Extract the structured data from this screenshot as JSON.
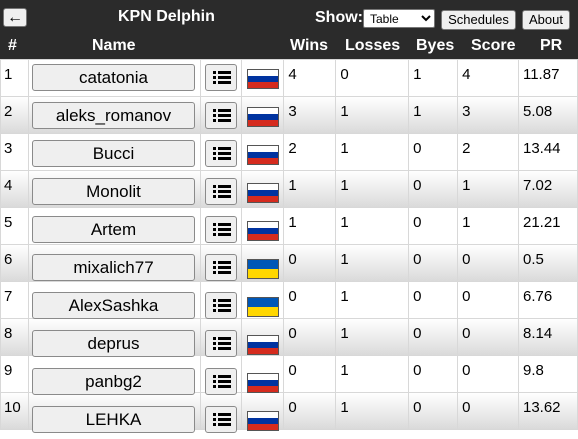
{
  "header": {
    "back_icon": "arrow-left-icon",
    "title": "KPN Delphin",
    "show_label": "Show:",
    "show_selected": "Table",
    "schedules_label": "Schedules",
    "about_label": "About"
  },
  "columns": {
    "rank": "#",
    "name": "Name",
    "wins": "Wins",
    "losses": "Losses",
    "byes": "Byes",
    "score": "Score",
    "pr": "PR"
  },
  "flag_colors": {
    "ru": [
      "#ffffff",
      "#0033a0",
      "#d52b1e"
    ],
    "ua": [
      "#0057b7",
      "#ffd700"
    ]
  },
  "rows": [
    {
      "rank": "1",
      "name": "catatonia",
      "flag": "ru",
      "wins": "4",
      "losses": "0",
      "byes": "1",
      "score": "4",
      "pr": "11.87"
    },
    {
      "rank": "2",
      "name": "aleks_romanov",
      "flag": "ru",
      "wins": "3",
      "losses": "1",
      "byes": "1",
      "score": "3",
      "pr": "5.08"
    },
    {
      "rank": "3",
      "name": "Bucci",
      "flag": "ru",
      "wins": "2",
      "losses": "1",
      "byes": "0",
      "score": "2",
      "pr": "13.44"
    },
    {
      "rank": "4",
      "name": "Monolit",
      "flag": "ru",
      "wins": "1",
      "losses": "1",
      "byes": "0",
      "score": "1",
      "pr": "7.02"
    },
    {
      "rank": "5",
      "name": "Artem",
      "flag": "ru",
      "wins": "1",
      "losses": "1",
      "byes": "0",
      "score": "1",
      "pr": "21.21"
    },
    {
      "rank": "6",
      "name": "mixalich77",
      "flag": "ua",
      "wins": "0",
      "losses": "1",
      "byes": "0",
      "score": "0",
      "pr": "0.5"
    },
    {
      "rank": "7",
      "name": "AlexSashka",
      "flag": "ua",
      "wins": "0",
      "losses": "1",
      "byes": "0",
      "score": "0",
      "pr": "6.76"
    },
    {
      "rank": "8",
      "name": "deprus",
      "flag": "ru",
      "wins": "0",
      "losses": "1",
      "byes": "0",
      "score": "0",
      "pr": "8.14"
    },
    {
      "rank": "9",
      "name": "panbg2",
      "flag": "ru",
      "wins": "0",
      "losses": "1",
      "byes": "0",
      "score": "0",
      "pr": "9.8"
    },
    {
      "rank": "10",
      "name": "LEHKA",
      "flag": "ru",
      "wins": "0",
      "losses": "1",
      "byes": "0",
      "score": "0",
      "pr": "13.62"
    }
  ]
}
